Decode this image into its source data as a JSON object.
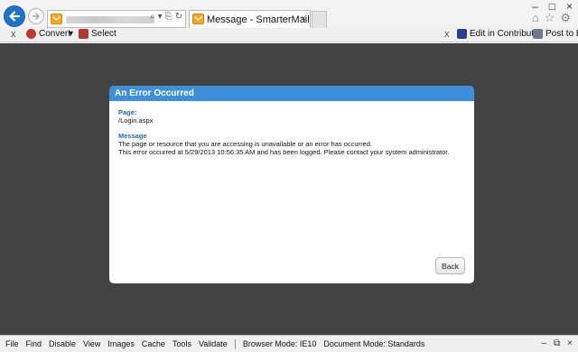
{
  "browser": {
    "tab_title": "Message - SmarterMail",
    "tab_close": "×",
    "window_controls": [
      "–",
      "□",
      "×"
    ],
    "side_icons": [
      "⌂",
      "☆",
      "⚙"
    ],
    "address_tools": [
      "⌕",
      "▾",
      "⎘",
      "↻"
    ]
  },
  "command_bar": {
    "close_left": "x",
    "convert_label": "Convert",
    "convert_arrow": "▾",
    "select_label": "Select",
    "close_right": "x",
    "edit_label": "Edit in Contribute",
    "post_label": "Post to Blo"
  },
  "dialog": {
    "title": "An Error Occurred",
    "page_label": "Page:",
    "page_value": "/Login.aspx",
    "message_label": "Message",
    "message_line1": "The page or resource that you are accessing is unavailable or an error has occurred.",
    "message_line2": "This error occurred at 5/29/2013 10:56:35 AM and has been logged. Please contact your system administrator.",
    "back_button": "Back"
  },
  "dev_toolbar": {
    "menu": [
      "File",
      "Find",
      "Disable",
      "View",
      "Images",
      "Cache",
      "Tools",
      "Validate"
    ],
    "browser_mode": "Browser Mode:  IE10",
    "document_mode": "Document Mode:  Standards",
    "controls": [
      "–",
      "⧉",
      "×"
    ]
  },
  "colors": {
    "accent": "#3f8ed8",
    "page_bg": "#424242",
    "label": "#2568b0"
  }
}
